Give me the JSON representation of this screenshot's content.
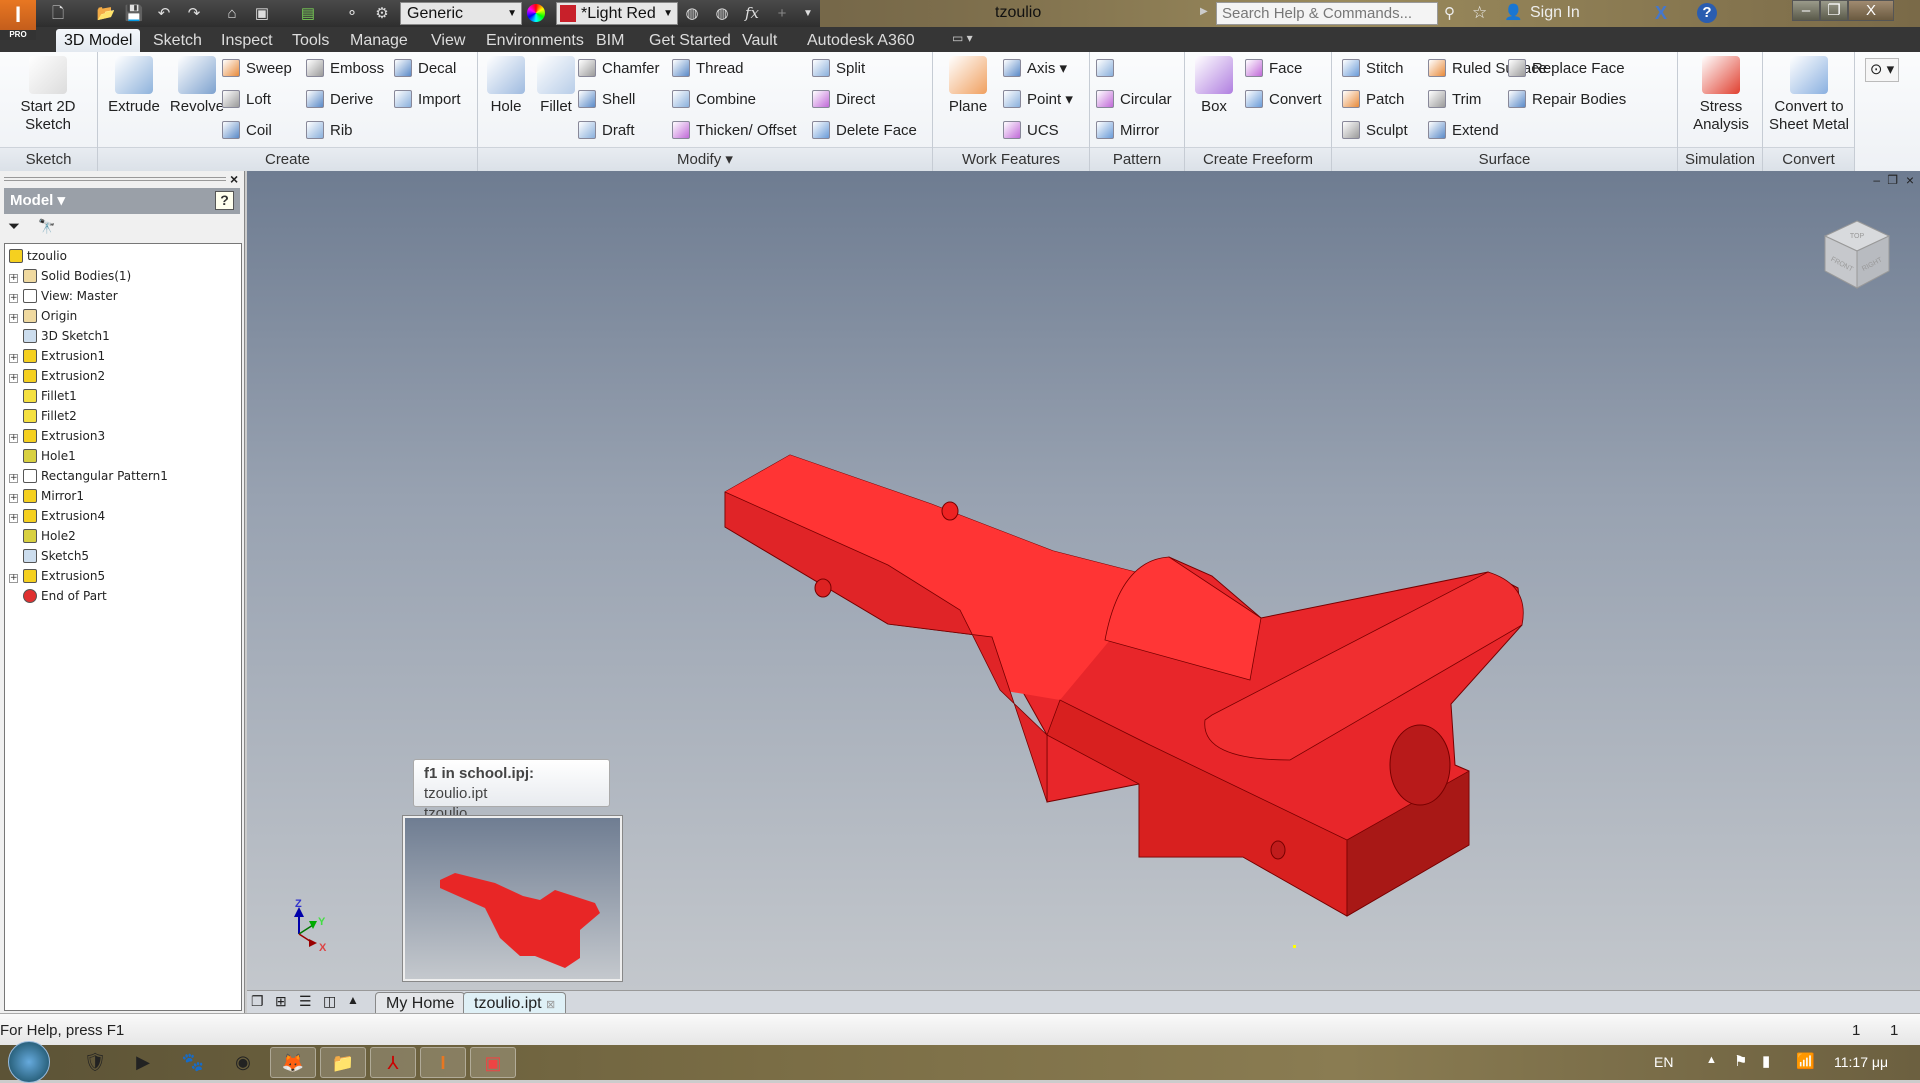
{
  "app": {
    "title": "tzoulio",
    "logo_text": "PRO"
  },
  "qat": {
    "appearance": "Generic",
    "material": "*Light Red",
    "material_color": "#c8202a",
    "formula_icon": "fx"
  },
  "search": {
    "placeholder": "Search Help & Commands..."
  },
  "account": {
    "sign_in": "Sign In"
  },
  "window_controls": {
    "minimize": "–",
    "restore": "❐",
    "close": "X"
  },
  "tabs": [
    "3D Model",
    "Sketch",
    "Inspect",
    "Tools",
    "Manage",
    "View",
    "Environments",
    "BIM",
    "Get Started",
    "Vault",
    "Autodesk A360"
  ],
  "ribbon": {
    "groups": [
      {
        "label": "Sketch",
        "big": [
          {
            "label": "Start 2D Sketch",
            "icon": "sketch-icon",
            "color": "#dcdcdc"
          }
        ],
        "small": []
      },
      {
        "label": "Create",
        "big": [
          {
            "label": "Extrude",
            "icon": "extrude-icon",
            "color": "#8fb3dc"
          },
          {
            "label": "Revolve",
            "icon": "revolve-icon",
            "color": "#7ea2cf"
          }
        ],
        "small": [
          [
            "Sweep",
            "Loft",
            "Coil"
          ],
          [
            "Emboss",
            "Derive",
            "Rib"
          ],
          [
            "Decal",
            "Import"
          ]
        ]
      },
      {
        "label": "Modify ▾",
        "big": [
          {
            "label": "Hole",
            "icon": "hole-icon",
            "color": "#9fbbe0"
          },
          {
            "label": "Fillet",
            "icon": "fillet-icon",
            "color": "#b8cde8"
          }
        ],
        "small": [
          [
            "Chamfer",
            "Shell",
            "Draft"
          ],
          [
            "Thread",
            "Combine",
            "Thicken/ Offset"
          ],
          [
            "Split",
            "Direct",
            "Delete Face"
          ]
        ]
      },
      {
        "label": "Work Features",
        "big": [
          {
            "label": "Plane",
            "icon": "plane-icon",
            "color": "#f0a060"
          }
        ],
        "small": [
          [
            "Axis ▾",
            "Point ▾",
            "UCS"
          ]
        ]
      },
      {
        "label": "Pattern",
        "big": [],
        "small": [
          [
            "",
            "Circular",
            "Mirror"
          ]
        ]
      },
      {
        "label": "Create Freeform",
        "big": [
          {
            "label": "Box",
            "icon": "box-icon",
            "color": "#b07fe0"
          }
        ],
        "small": [
          [
            "Face",
            "Convert"
          ]
        ]
      },
      {
        "label": "Surface",
        "big": [],
        "small": [
          [
            "Stitch",
            "Patch",
            "Sculpt"
          ],
          [
            "Ruled Surface",
            "Trim",
            "Extend"
          ],
          [
            "Replace Face",
            "Repair Bodies"
          ]
        ]
      },
      {
        "label": "Simulation",
        "big": [
          {
            "label": "Stress Analysis",
            "icon": "stress-analysis-icon",
            "color": "#e04030"
          }
        ],
        "small": []
      },
      {
        "label": "Convert",
        "big": [
          {
            "label": "Convert to Sheet Metal",
            "icon": "sheet-metal-icon",
            "color": "#8ab0e0"
          }
        ],
        "small": []
      }
    ]
  },
  "browser": {
    "title": "Model ▾",
    "help": "?",
    "close": "×",
    "items": [
      {
        "label": "tzoulio",
        "icon": "part-icon",
        "expand": false,
        "root": true
      },
      {
        "label": "Solid Bodies(1)",
        "icon": "folder-icon",
        "expand": true
      },
      {
        "label": "View: Master",
        "icon": "view-icon",
        "expand": true
      },
      {
        "label": "Origin",
        "icon": "folder-icon",
        "expand": true
      },
      {
        "label": "3D Sketch1",
        "icon": "sketch-icon",
        "expand": false
      },
      {
        "label": "Extrusion1",
        "icon": "extrusion-icon",
        "expand": true
      },
      {
        "label": "Extrusion2",
        "icon": "extrusion-icon",
        "expand": true
      },
      {
        "label": "Fillet1",
        "icon": "fillet-icon",
        "expand": false
      },
      {
        "label": "Fillet2",
        "icon": "fillet-icon",
        "expand": false
      },
      {
        "label": "Extrusion3",
        "icon": "extrusion-icon",
        "expand": true
      },
      {
        "label": "Hole1",
        "icon": "hole-icon",
        "expand": false
      },
      {
        "label": "Rectangular Pattern1",
        "icon": "pattern-icon",
        "expand": true
      },
      {
        "label": "Mirror1",
        "icon": "mirror-icon",
        "expand": true
      },
      {
        "label": "Extrusion4",
        "icon": "extrusion-icon",
        "expand": true
      },
      {
        "label": "Hole2",
        "icon": "hole-icon",
        "expand": false
      },
      {
        "label": "Sketch5",
        "icon": "sketch-icon",
        "expand": false
      },
      {
        "label": "Extrusion5",
        "icon": "extrusion-icon",
        "expand": true
      },
      {
        "label": "End of Part",
        "icon": "end-of-part-icon",
        "expand": false
      }
    ]
  },
  "viewcube": {
    "top": "TOP",
    "front": "FRONT",
    "right": "RIGHT"
  },
  "triad": {
    "x": "X",
    "y": "Y",
    "z": "Z"
  },
  "tooltip": {
    "project": "f1 in school.ipj:",
    "file": "tzoulio.ipt",
    "name": "tzoulio"
  },
  "doc_tabs": [
    "My Home",
    "tzoulio.ipt"
  ],
  "status": {
    "help": "For Help, press F1",
    "count1": "1",
    "count2": "1"
  },
  "taskbar": {
    "lang": "EN",
    "time": "11:17 μμ"
  },
  "colors": {
    "part": "#ff3333",
    "accent": "#e87722"
  }
}
